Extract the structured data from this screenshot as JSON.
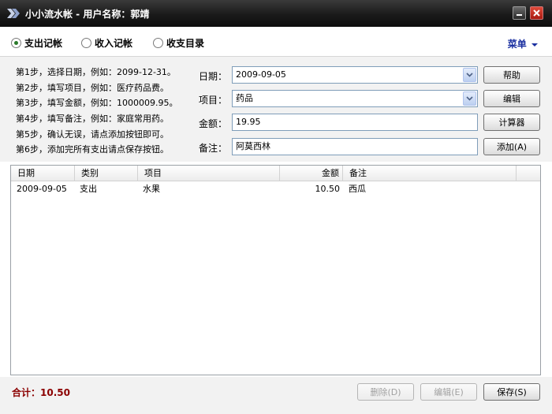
{
  "window": {
    "title": "小小流水帐 - 用户名称：郭靖"
  },
  "tabs": [
    {
      "label": "支出记帐",
      "checked": true
    },
    {
      "label": "收入记帐",
      "checked": false
    },
    {
      "label": "收支目录",
      "checked": false
    }
  ],
  "menu": {
    "label": "菜单"
  },
  "steps": [
    "第1步，选择日期，例如：2099-12-31。",
    "第2步，填写项目，例如：医疗药品费。",
    "第3步，填写金额，例如：1000009.95。",
    "第4步，填写备注，例如：家庭常用药。",
    "第5步，确认无误，请点添加按钮即可。",
    "第6步，添加完所有支出请点保存按钮。"
  ],
  "form": {
    "date": {
      "label": "日期：",
      "value": "2009-09-05"
    },
    "item": {
      "label": "项目：",
      "value": "药品"
    },
    "amount": {
      "label": "金额：",
      "value": "19.95"
    },
    "note": {
      "label": "备注：",
      "value": "阿莫西林"
    }
  },
  "buttons": {
    "help": "帮助",
    "edit_items": "编辑",
    "calculator": "计算器",
    "add": "添加(A)",
    "delete": "删除(D)",
    "edit": "编辑(E)",
    "save": "保存(S)"
  },
  "table": {
    "columns": [
      "日期",
      "类别",
      "项目",
      "金额",
      "备注"
    ],
    "rows": [
      {
        "date": "2009-09-05",
        "category": "支出",
        "item": "水果",
        "amount": "10.50",
        "note": "西瓜"
      }
    ]
  },
  "footer": {
    "total": "合计：10.50"
  },
  "colors": {
    "title_bar": "#1a1a1a",
    "menu_link": "#1a2fa0",
    "total_text": "#8b0000",
    "close_button": "#c0281c"
  }
}
